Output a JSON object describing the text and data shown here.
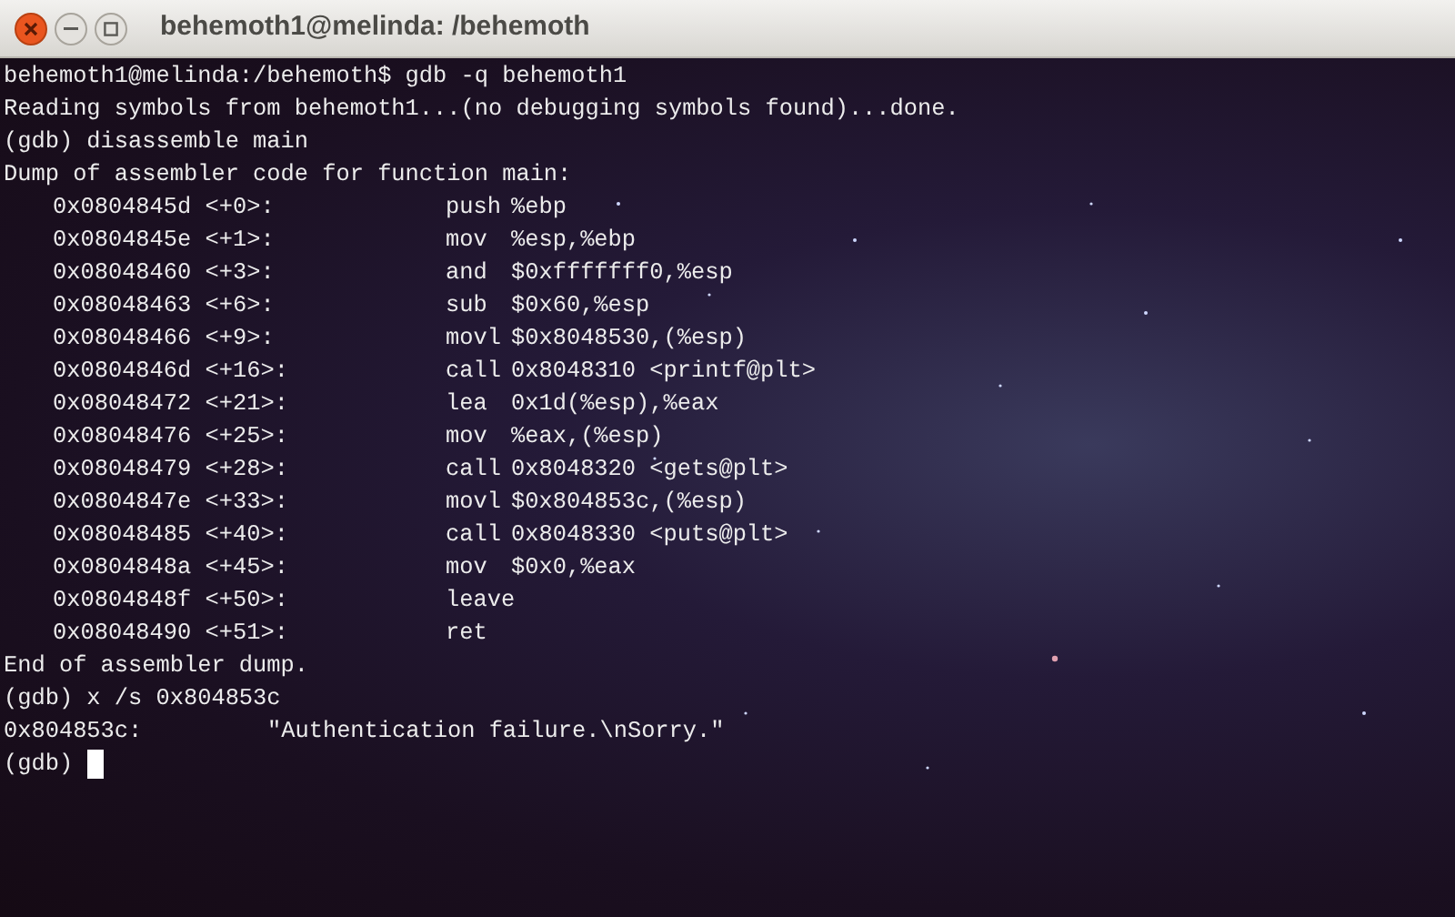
{
  "window": {
    "title": "behemoth1@melinda: /behemoth"
  },
  "terminal": {
    "lines": [
      {
        "kind": "text",
        "text": "behemoth1@melinda:/behemoth$ gdb -q behemoth1"
      },
      {
        "kind": "text",
        "text": "Reading symbols from behemoth1...(no debugging symbols found)...done."
      },
      {
        "kind": "text",
        "text": "(gdb) disassemble main"
      },
      {
        "kind": "text",
        "text": "Dump of assembler code for function main:"
      },
      {
        "kind": "instruction",
        "address": "0x0804845d <+0>:",
        "mnemonic": "push",
        "operands": "%ebp"
      },
      {
        "kind": "instruction",
        "address": "0x0804845e <+1>:",
        "mnemonic": "mov",
        "operands": "%esp,%ebp"
      },
      {
        "kind": "instruction",
        "address": "0x08048460 <+3>:",
        "mnemonic": "and",
        "operands": "$0xfffffff0,%esp"
      },
      {
        "kind": "instruction",
        "address": "0x08048463 <+6>:",
        "mnemonic": "sub",
        "operands": "$0x60,%esp"
      },
      {
        "kind": "instruction",
        "address": "0x08048466 <+9>:",
        "mnemonic": "movl",
        "operands": "$0x8048530,(%esp)"
      },
      {
        "kind": "instruction",
        "address": "0x0804846d <+16>:",
        "mnemonic": "call",
        "operands": "0x8048310 <printf@plt>"
      },
      {
        "kind": "instruction",
        "address": "0x08048472 <+21>:",
        "mnemonic": "lea",
        "operands": "0x1d(%esp),%eax"
      },
      {
        "kind": "instruction",
        "address": "0x08048476 <+25>:",
        "mnemonic": "mov",
        "operands": "%eax,(%esp)"
      },
      {
        "kind": "instruction",
        "address": "0x08048479 <+28>:",
        "mnemonic": "call",
        "operands": "0x8048320 <gets@plt>"
      },
      {
        "kind": "instruction",
        "address": "0x0804847e <+33>:",
        "mnemonic": "movl",
        "operands": "$0x804853c,(%esp)"
      },
      {
        "kind": "instruction",
        "address": "0x08048485 <+40>:",
        "mnemonic": "call",
        "operands": "0x8048330 <puts@plt>"
      },
      {
        "kind": "instruction",
        "address": "0x0804848a <+45>:",
        "mnemonic": "mov",
        "operands": "$0x0,%eax"
      },
      {
        "kind": "instruction",
        "address": "0x0804848f <+50>:",
        "mnemonic": "leave"
      },
      {
        "kind": "instruction",
        "address": "0x08048490 <+51>:",
        "mnemonic": "ret"
      },
      {
        "kind": "text",
        "text": "End of assembler dump."
      },
      {
        "kind": "text",
        "text": "(gdb) x /s 0x804853c"
      },
      {
        "kind": "string",
        "address": "0x804853c:",
        "value": "\"Authentication failure.\\nSorry.\""
      },
      {
        "kind": "prompt",
        "text": "(gdb)"
      }
    ]
  }
}
